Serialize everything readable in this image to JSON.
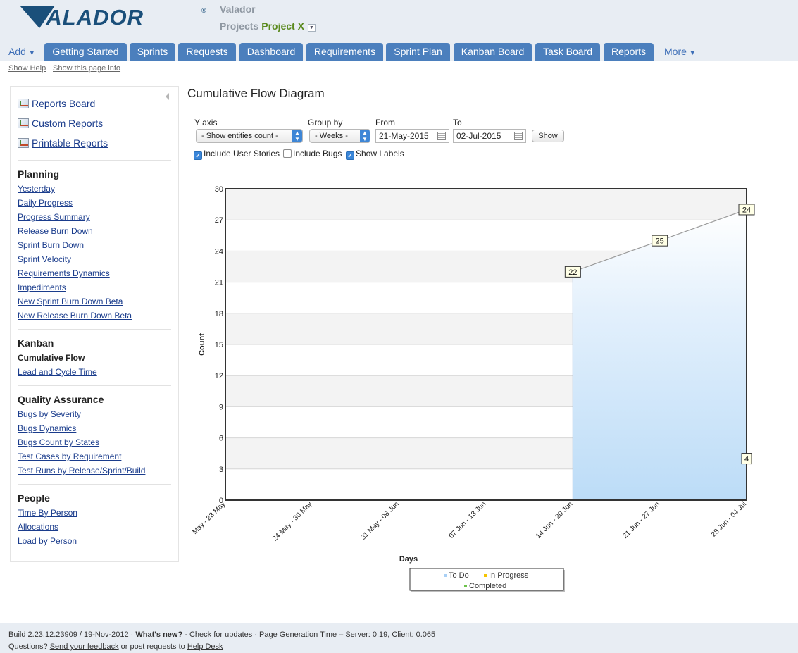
{
  "header": {
    "logo_text": "VALADOR",
    "company": "Valador",
    "projects_label": "Projects",
    "project_name": "Project X"
  },
  "nav": {
    "add_label": "Add",
    "more_label": "More",
    "tabs": [
      {
        "label": "Getting Started"
      },
      {
        "label": "Sprints"
      },
      {
        "label": "Requests"
      },
      {
        "label": "Dashboard"
      },
      {
        "label": "Requirements"
      },
      {
        "label": "Sprint Plan"
      },
      {
        "label": "Kanban Board"
      },
      {
        "label": "Task Board"
      },
      {
        "label": "Reports"
      }
    ],
    "show_help": "Show Help",
    "show_page_info": "Show this page info"
  },
  "sidebar": {
    "top_links": [
      "Reports Board",
      "Custom Reports",
      "Printable Reports"
    ],
    "sections": [
      {
        "heading": "Planning",
        "items": [
          "Yesterday",
          "Daily Progress",
          "Progress Summary",
          "Release Burn Down",
          "Sprint Burn Down",
          "Sprint Velocity",
          "Requirements Dynamics",
          "Impediments",
          "New Sprint Burn Down Beta",
          "New Release Burn Down Beta"
        ]
      },
      {
        "heading": "Kanban",
        "current": "Cumulative Flow",
        "items": [
          "Lead and Cycle Time"
        ]
      },
      {
        "heading": "Quality Assurance",
        "items": [
          "Bugs by Severity",
          "Bugs Dynamics",
          "Bugs Count by States",
          "Test Cases by Requirement",
          "Test Runs by Release/Sprint/Build"
        ]
      },
      {
        "heading": "People",
        "items": [
          "Time By Person",
          "Allocations",
          "Load by Person"
        ]
      }
    ]
  },
  "report": {
    "title": "Cumulative Flow Diagram",
    "y_axis_label": "Y axis",
    "y_axis_value": "- Show entities count -",
    "group_by_label": "Group by",
    "group_by_value": "- Weeks -",
    "from_label": "From",
    "from_value": "21-May-2015",
    "to_label": "To",
    "to_value": "02-Jul-2015",
    "show_button": "Show",
    "include_user_stories": {
      "label": "Include User Stories",
      "checked": true
    },
    "include_bugs": {
      "label": "Include Bugs",
      "checked": false
    },
    "show_labels": {
      "label": "Show Labels",
      "checked": true
    }
  },
  "chart_data": {
    "type": "area",
    "xlabel": "Days",
    "ylabel": "Count",
    "ylim": [
      0,
      30
    ],
    "yticks": [
      0,
      3,
      6,
      9,
      12,
      15,
      18,
      21,
      24,
      27,
      30
    ],
    "categories": [
      "May - 23 May",
      "24 May - 30 May",
      "31 May - 06 Jun",
      "07 Jun - 13 Jun",
      "14 Jun - 20 Jun",
      "21 Jun - 27 Jun",
      "28 Jun - 04 Jul"
    ],
    "series": [
      {
        "name": "To Do",
        "color": "#a9d0f5",
        "values": [
          null,
          null,
          null,
          null,
          22,
          25,
          28
        ]
      }
    ],
    "data_labels": [
      {
        "category": "14 Jun - 20 Jun",
        "value": 22,
        "text": "22"
      },
      {
        "category": "21 Jun - 27 Jun",
        "value": 25,
        "text": "25"
      },
      {
        "category": "28 Jun - 04 Jul",
        "value": 28,
        "text": "24"
      },
      {
        "category": "28 Jun - 04 Jul",
        "value": 4,
        "text": "4"
      }
    ],
    "legend": [
      {
        "label": "To Do",
        "color": "#a9d0f5"
      },
      {
        "label": "In Progress",
        "color": "#f5c400"
      },
      {
        "label": "Completed",
        "color": "#6cc24a"
      }
    ],
    "legend_position": "bottom",
    "grid": true
  },
  "footer": {
    "build": "Build 2.23.12.23909 / 19-Nov-2012",
    "whats_new": "What's new?",
    "check_updates": "Check for updates",
    "generation": "Page Generation Time – Server: 0.19, Client: 0.065",
    "questions": "Questions?",
    "feedback": "Send your feedback",
    "or_post": "or post requests to",
    "help_desk": "Help Desk"
  }
}
